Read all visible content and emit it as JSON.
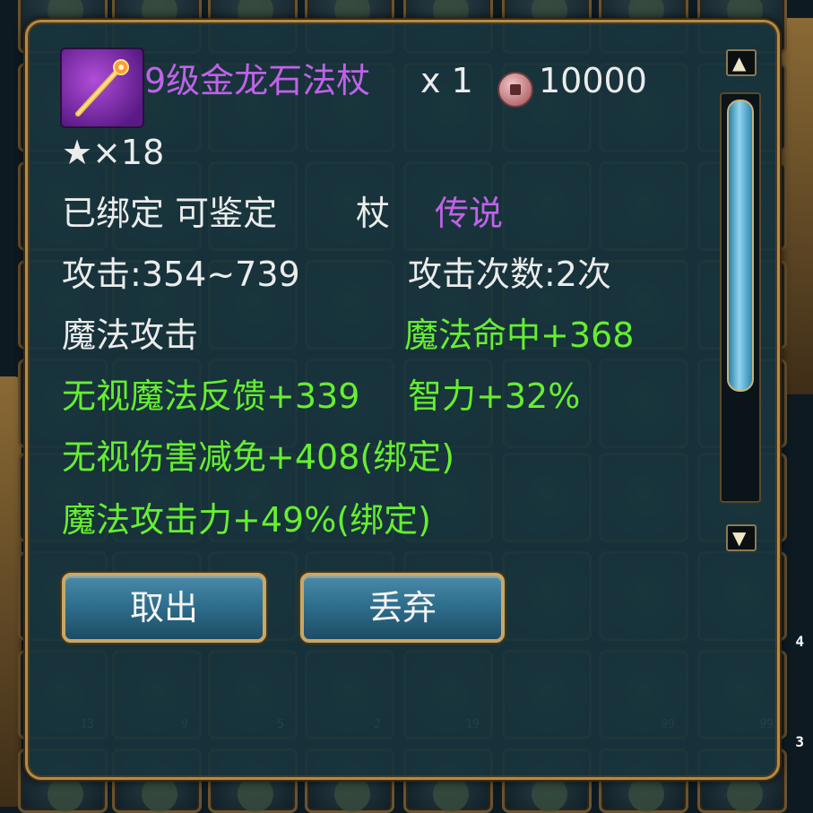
{
  "item": {
    "name": "9级金龙石法杖",
    "quantity": "x 1",
    "price": "10000",
    "stars": "★×18",
    "bind_status": "已绑定 可鉴定",
    "weapon_type": "杖",
    "rarity": "传说",
    "attack": "攻击:354~739",
    "attack_count": "攻击次数:2次",
    "attack_type": "魔法攻击",
    "stats": {
      "magic_hit": "魔法命中+368",
      "ignore_magic_feedback": "无视魔法反馈+339",
      "intelligence": "智力+32%",
      "ignore_damage_reduction": "无视伤害减免+408(绑定)",
      "magic_attack_power": "魔法攻击力+49%(绑定)"
    }
  },
  "buttons": {
    "take_out": "取出",
    "discard": "丢弃"
  },
  "scrollbar": {
    "up": "▲",
    "down": "▼"
  },
  "background": {
    "slot_counts": [
      "13",
      "9",
      "5",
      "2",
      "19",
      "",
      "99",
      "99"
    ],
    "side_numbers": [
      "4",
      "3"
    ]
  },
  "colors": {
    "panel_bg": "#18343c",
    "panel_border": "#b58a45",
    "stat_green": "#66ee30",
    "rarity_purple": "#c062e8",
    "text_white": "#ececec"
  }
}
